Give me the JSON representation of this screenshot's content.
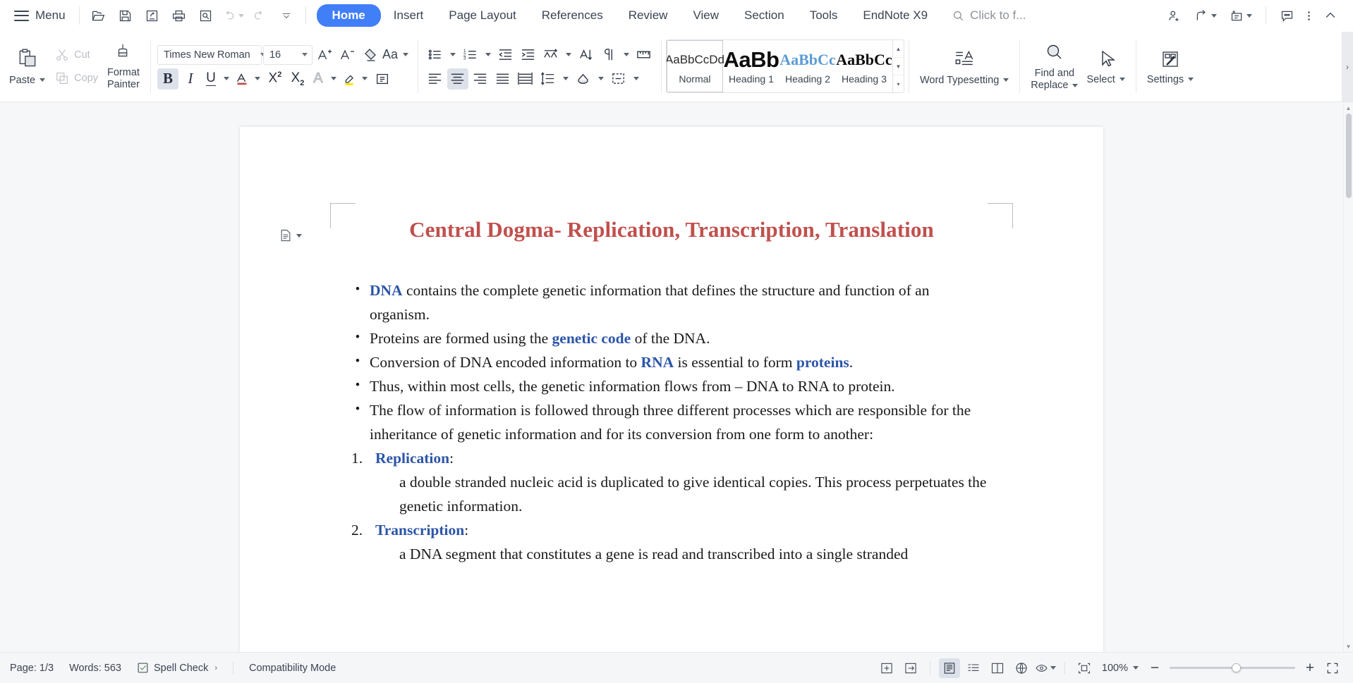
{
  "topbar": {
    "menu_label": "Menu",
    "quick_icons": [
      "open-folder-icon",
      "save-icon",
      "save-as-icon",
      "print-icon",
      "print-preview-icon",
      "undo-icon",
      "redo-icon",
      "quick-access-more-icon"
    ],
    "tabs": [
      {
        "label": "Home",
        "active": true
      },
      {
        "label": "Insert",
        "active": false
      },
      {
        "label": "Page Layout",
        "active": false
      },
      {
        "label": "References",
        "active": false
      },
      {
        "label": "Review",
        "active": false
      },
      {
        "label": "View",
        "active": false
      },
      {
        "label": "Section",
        "active": false
      },
      {
        "label": "Tools",
        "active": false
      },
      {
        "label": "EndNote X9",
        "active": false
      }
    ],
    "search_placeholder": "Click to f...",
    "right_icons": [
      "share-user-icon",
      "share-icon",
      "new-note-icon",
      "comment-icon",
      "more-options-icon",
      "collapse-ribbon-icon"
    ]
  },
  "ribbon": {
    "clipboard": {
      "paste_label": "Paste",
      "cut_label": "Cut",
      "copy_label": "Copy",
      "format_painter_label": "Format Painter"
    },
    "font": {
      "family": "Times New Roman",
      "size": "16",
      "grow_label": "A+",
      "shrink_label": "A-",
      "bold_label": "B",
      "italic_label": "I",
      "underline_label": "U",
      "superscript_label": "X",
      "superscript_sup": "2",
      "subscript_label": "X",
      "subscript_sub": "2",
      "text_effects_label": "A",
      "change_case_label": "Aa",
      "bold_active": true
    },
    "styles": {
      "items": [
        {
          "preview": "AaBbCcDd",
          "name": "Normal",
          "selected": true
        },
        {
          "preview": "AaBb",
          "name": "Heading 1",
          "selected": false
        },
        {
          "preview": "AaBbCc",
          "name": "Heading 2",
          "selected": false
        },
        {
          "preview": "AaBbCc",
          "name": "Heading 3",
          "selected": false
        }
      ]
    },
    "right_groups": {
      "word_typesetting": "Word Typesetting",
      "find_and_replace_line1": "Find and",
      "find_and_replace_line2": "Replace",
      "select": "Select",
      "settings": "Settings"
    }
  },
  "document": {
    "title": "Central Dogma- Replication, Transcription, Translation",
    "title_color": "#c0504d",
    "blocks": [
      {
        "type": "bullet",
        "marker": "•",
        "runs": [
          {
            "t": "DNA",
            "bold": true
          },
          {
            "t": " contains the complete genetic information that defines the structure and function of an organism.",
            "bold": false
          }
        ]
      },
      {
        "type": "bullet",
        "marker": "•",
        "runs": [
          {
            "t": "Proteins are formed using the ",
            "bold": false
          },
          {
            "t": "genetic code",
            "bold": true
          },
          {
            "t": " of the DNA.",
            "bold": false
          }
        ]
      },
      {
        "type": "bullet",
        "marker": "•",
        "runs": [
          {
            "t": "Conversion of DNA encoded information to ",
            "bold": false
          },
          {
            "t": "RNA",
            "bold": true
          },
          {
            "t": " is essential to form ",
            "bold": false
          },
          {
            "t": "proteins",
            "bold": true
          },
          {
            "t": ".",
            "bold": false
          }
        ]
      },
      {
        "type": "bullet",
        "marker": "•",
        "runs": [
          {
            "t": "Thus, within most cells, the genetic information flows from – DNA to RNA to protein.",
            "bold": false
          }
        ]
      },
      {
        "type": "bullet",
        "marker": "•",
        "runs": [
          {
            "t": "The flow of information is followed through three different processes which are responsible for the inheritance of genetic information and for its conversion from one form to another:",
            "bold": false
          }
        ]
      },
      {
        "type": "number",
        "marker": "1.",
        "runs": [
          {
            "t": "Replication",
            "bold": true
          },
          {
            "t": ":",
            "bold": false
          }
        ]
      },
      {
        "type": "indent",
        "marker": "",
        "runs": [
          {
            "t": "a double stranded nucleic acid is duplicated to give identical copies. This process perpetuates the genetic information.",
            "bold": false
          }
        ]
      },
      {
        "type": "number",
        "marker": "2.",
        "runs": [
          {
            "t": "Transcription",
            "bold": true
          },
          {
            "t": ":",
            "bold": false
          }
        ]
      },
      {
        "type": "indent",
        "marker": "",
        "runs": [
          {
            "t": "a DNA segment that constitutes a gene is read and transcribed into a single stranded",
            "bold": false
          }
        ]
      }
    ]
  },
  "status": {
    "page": "Page: 1/3",
    "words": "Words: 563",
    "spell_check": "Spell Check",
    "compatibility": "Compatibility Mode",
    "zoom": "100%",
    "view_buttons": [
      "web-layout-icon",
      "outline-icon",
      "print-layout-icon",
      "reading-layout-icon",
      "full-screen-reading-icon",
      "web-view-icon",
      "eye-protection-icon"
    ],
    "fit_page_icon": "fit-page-icon",
    "zoom_out": "−",
    "zoom_in": "+",
    "full_screen_icon": "full-screen-icon"
  }
}
